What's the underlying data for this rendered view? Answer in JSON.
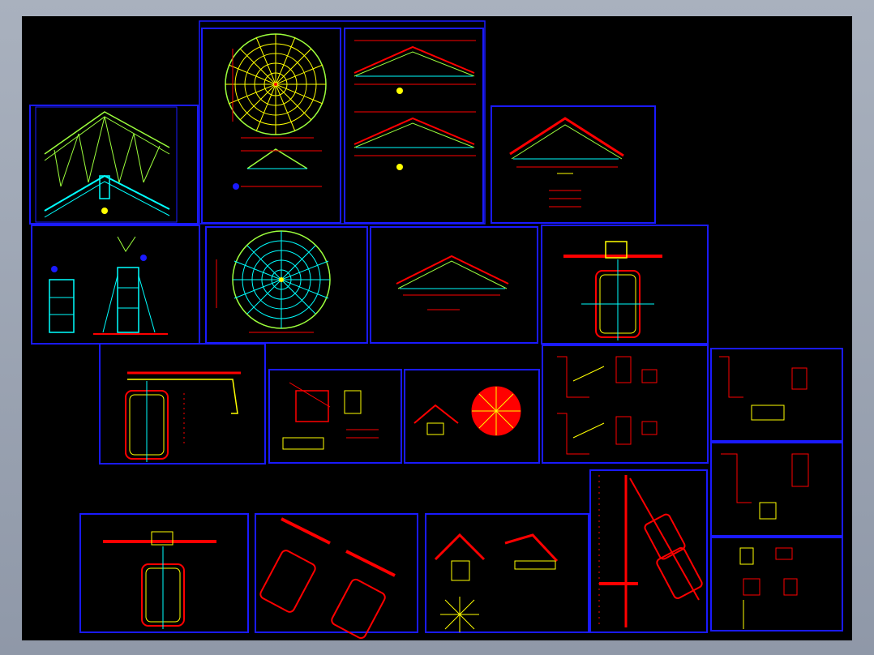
{
  "view": {
    "background": "#000000",
    "frame_color": "#0000ff",
    "sheet_count": 20
  },
  "palette": {
    "yellow": "#ffff00",
    "green": "#9cff3c",
    "cyan": "#00ffff",
    "red": "#ff0000",
    "white": "#ffffff",
    "blue": "#1a1aff",
    "magenta": "#ff00ff"
  },
  "sheets": [
    {
      "id": "truss-elevation",
      "kind": "truss"
    },
    {
      "id": "dome-plan-1",
      "kind": "dome"
    },
    {
      "id": "roof-sections-1",
      "kind": "roof-pair"
    },
    {
      "id": "roof-section-tiled",
      "kind": "roof-tiled"
    },
    {
      "id": "truss-details",
      "kind": "ladder"
    },
    {
      "id": "dome-plan-2",
      "kind": "dome"
    },
    {
      "id": "roof-section-2",
      "kind": "roof-single"
    },
    {
      "id": "ridge-purlin-section",
      "kind": "box-section"
    },
    {
      "id": "eave-gutter-section",
      "kind": "gutter"
    },
    {
      "id": "connection-details-1",
      "kind": "connection"
    },
    {
      "id": "ridge-star-detail",
      "kind": "star"
    },
    {
      "id": "joint-details-1",
      "kind": "joints"
    },
    {
      "id": "joint-details-2",
      "kind": "joints-small"
    },
    {
      "id": "joint-details-3",
      "kind": "joints-small"
    },
    {
      "id": "joint-details-4",
      "kind": "joints-small"
    },
    {
      "id": "purlin-section-large",
      "kind": "box-section"
    },
    {
      "id": "inclined-purlin-sections",
      "kind": "tilted"
    },
    {
      "id": "ridge-cap-details",
      "kind": "ridge-cap"
    },
    {
      "id": "wall-purlin-section",
      "kind": "wall-tilt"
    }
  ]
}
